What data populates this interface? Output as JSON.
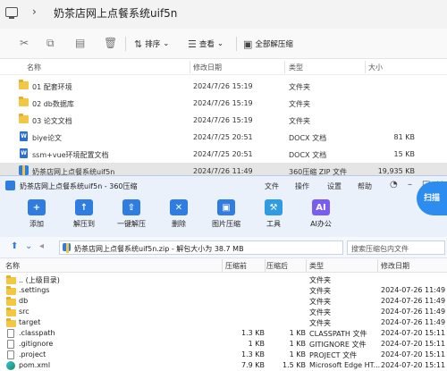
{
  "explorer": {
    "breadcrumb": "奶茶店网上点餐系统uif5n",
    "toolbar": {
      "sort": "排序",
      "view": "查看",
      "extract_all": "全部解压缩"
    },
    "columns": [
      "名称",
      "修改日期",
      "类型",
      "大小"
    ],
    "files": [
      {
        "name": "01 配套环境",
        "date": "2024/7/26 15:19",
        "type": "文件夹",
        "size": "",
        "icon": "folder"
      },
      {
        "name": "02 db数据库",
        "date": "2024/7/26 15:19",
        "type": "文件夹",
        "size": "",
        "icon": "folder"
      },
      {
        "name": "03 论文文档",
        "date": "2024/7/26 15:19",
        "type": "文件夹",
        "size": "",
        "icon": "folder"
      },
      {
        "name": "biye论文",
        "date": "2024/7/25 20:51",
        "type": "DOCX 文档",
        "size": "81 KB",
        "icon": "docx"
      },
      {
        "name": "ssm+vue环境配置文档",
        "date": "2024/7/25 20:51",
        "type": "DOCX 文档",
        "size": "15 KB",
        "icon": "docx"
      },
      {
        "name": "奶茶店网上点餐系统uif5n",
        "date": "2024/7/26 11:49",
        "type": "360压缩 ZIP 文件",
        "size": "19,935 KB",
        "icon": "zip"
      }
    ]
  },
  "zip_window": {
    "title": "奶茶店网上点餐系统uif5n - 360压缩",
    "menu": [
      "文件",
      "操作",
      "设置",
      "帮助"
    ],
    "tools": [
      {
        "label": "添加",
        "color": "#2f7de1",
        "glyph": "+"
      },
      {
        "label": "解压到",
        "color": "#2f7de1",
        "glyph": "↑"
      },
      {
        "label": "一键解压",
        "color": "#2f7de1",
        "glyph": "⇧"
      },
      {
        "label": "删除",
        "color": "#2f7de1",
        "glyph": "✕"
      },
      {
        "label": "图片压缩",
        "color": "#2f7de1",
        "glyph": "▣"
      },
      {
        "label": "工具",
        "color": "#2f9be1",
        "glyph": "⚒"
      },
      {
        "label": "AI办公",
        "color": "#7b5cf0",
        "glyph": "AI"
      }
    ],
    "scan_label": "扫描",
    "path": "奶茶店网上点餐系统uif5n.zip - 解包大小为 38.7 MB",
    "search_placeholder": "搜索压缩包内文件",
    "columns": [
      "名称",
      "压缩前",
      "压缩后",
      "类型",
      "修改日期"
    ],
    "entries": [
      {
        "name": ".. (上级目录)",
        "before": "",
        "after": "",
        "type": "文件夹",
        "date": "",
        "icon": "folder"
      },
      {
        "name": ".settings",
        "before": "",
        "after": "",
        "type": "文件夹",
        "date": "2024-07-26 11:49",
        "icon": "folder"
      },
      {
        "name": "db",
        "before": "",
        "after": "",
        "type": "文件夹",
        "date": "2024-07-26 11:49",
        "icon": "folder"
      },
      {
        "name": "src",
        "before": "",
        "after": "",
        "type": "文件夹",
        "date": "2024-07-26 11:49",
        "icon": "folder"
      },
      {
        "name": "target",
        "before": "",
        "after": "",
        "type": "文件夹",
        "date": "2024-07-26 11:49",
        "icon": "folder"
      },
      {
        "name": ".classpath",
        "before": "1.3 KB",
        "after": "1 KB",
        "type": "CLASSPATH 文件",
        "date": "2024-07-20 15:11",
        "icon": "file"
      },
      {
        "name": ".gitignore",
        "before": "1 KB",
        "after": "1 KB",
        "type": "GITIGNORE 文件",
        "date": "2024-07-20 15:11",
        "icon": "file"
      },
      {
        "name": ".project",
        "before": "1.3 KB",
        "after": "1 KB",
        "type": "PROJECT 文件",
        "date": "2024-07-20 15:11",
        "icon": "file"
      },
      {
        "name": "pom.xml",
        "before": "7.9 KB",
        "after": "1.5 KB",
        "type": "Microsoft Edge HT...",
        "date": "2024-07-20 15:11",
        "icon": "edge"
      }
    ]
  }
}
